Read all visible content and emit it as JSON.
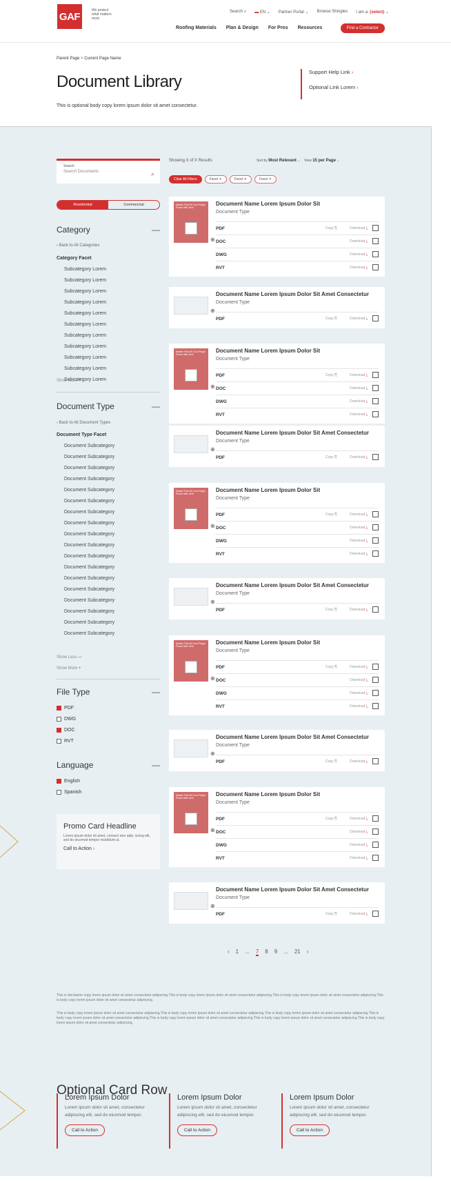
{
  "header": {
    "logo": "GAF",
    "tagline": "We protect what matters most",
    "search": "Search",
    "lang": "EN",
    "partner": "Partner Portal",
    "browse": "Browse Shingles",
    "iam": "I am a:",
    "iam_sel": "(select)",
    "nav": [
      "Roofing Materials",
      "Plan & Design",
      "For Pros",
      "Resources"
    ],
    "cta": "Find a Contractor"
  },
  "breadcrumb": {
    "parent": "Parent Page",
    "arrow": ">",
    "current": "Current Page Name"
  },
  "title": "Document Library",
  "intro": "This is optional body copy lorem ipsum dolor sit amet consectetur.",
  "side_links": [
    "Support Help Link",
    "Optional Link Lorem"
  ],
  "search": {
    "label": "Search",
    "placeholder": "Search Documents"
  },
  "toggle": [
    "Residential",
    "Commercial"
  ],
  "category": {
    "title": "Category",
    "back": "Back to All Categories",
    "facet": "Category Facet",
    "subs": [
      "Subcategory Lorem",
      "Subcategory Lorem",
      "Subcategory Lorem",
      "Subcategory Lorem",
      "Subcategory Lorem",
      "Subcategory Lorem",
      "Subcategory Lorem",
      "Subcategory Lorem",
      "Subcategory Lorem",
      "Subcategory Lorem",
      "Subcategory Lorem"
    ],
    "more": "Show More"
  },
  "doctype": {
    "title": "Document Type",
    "back": "Back to All Document Types",
    "facet": "Document Type Facet",
    "subs": [
      "Document Subcategory",
      "Document Subcategory",
      "Document Subcategory",
      "Document Subcategory",
      "Document Subcategory",
      "Document Subcategory",
      "Document Subcategory",
      "Document Subcategory",
      "Document Subcategory",
      "Document Subcategory",
      "Document Subcategory",
      "Document Subcategory",
      "Document Subcategory",
      "Document Subcategory",
      "Document Subcategory",
      "Document Subcategory",
      "Document Subcategory",
      "Document Subcategory"
    ],
    "less": "Show Less",
    "more": "Show More"
  },
  "filetype": {
    "title": "File Type",
    "items": [
      {
        "label": "PDF",
        "checked": true
      },
      {
        "label": "DWG",
        "checked": false
      },
      {
        "label": "DOC",
        "checked": true
      },
      {
        "label": "RVT",
        "checked": false
      }
    ]
  },
  "language": {
    "title": "Language",
    "items": [
      {
        "label": "English",
        "checked": true
      },
      {
        "label": "Spanish",
        "checked": false
      }
    ]
  },
  "promo": {
    "title": "Promo Card Headline",
    "body": "Lorem ipsum dolor sit amet, consect etur adip. iscing elit, sed do eiusmod tempor incididunt ut.",
    "cta": "Call to Action"
  },
  "results": {
    "showing": "Showing X of X Results",
    "sort_label": "Sort by",
    "sort_value": "Most Relevant",
    "view_label": "View",
    "view_value": "15 per Page",
    "clear": "Clear All Filters",
    "facets": [
      "Facet",
      "Facet",
      "Facet"
    ]
  },
  "docs": {
    "name_a": "Document Name Lorem Ipsum Dolor Sit",
    "name_b": "Document Name Lorem Ipsum Dolor Sit Amet Consectetur",
    "type": "Document Type",
    "copy": "Copy",
    "download": "Download",
    "thumb_text": "Master Flow Ell Cool Plugin Power Attic Vent",
    "formats_a": [
      "PDF",
      "DOC",
      "DWG",
      "RVT"
    ],
    "formats_b": [
      "PDF"
    ]
  },
  "pagination": [
    "‹",
    "1",
    "...",
    "7",
    "8",
    "9",
    "...",
    "21",
    "›"
  ],
  "disclaimer": [
    "This is disclaimer copy lorem ipsum dolor sit amet consectetur adipiscing.This is body copy lorem ipsum dolor sit amet consectetur adipiscing.This is body copy lorem ipsum dolor sit amet consectetur adipiscing.This is body copy lorem ipsum dolor sit amet consectetur adipiscing.",
    "This is body copy lorem ipsum dolor sit amet consectetur adipiscing.This is body copy lorem ipsum dolor sit amet consectetur adipiscing.This is body copy lorem ipsum dolor sit amet consectetur adipiscing.This is body copy lorem ipsum dolor sit amet consectetur adipiscing.This is body copy lorem ipsum dolor sit amet consectetur adipiscing.This is body copy lorem ipsum dolor sit amet consectetur adipiscing.This is body copy lorem ipsum dolor sit amet consectetur adipiscing."
  ],
  "card_row": {
    "title": "Optional Card Row",
    "cards": [
      {
        "title": "Lorem Ipsum Dolor",
        "body": "Lorem ipsum dolor sit amet, consectetur adipiscing elit, sed do eiusmod tempor.",
        "cta": "Call to Action"
      },
      {
        "title": "Lorem Ipsum Dolor",
        "body": "Lorem ipsum dolor sit amet, consectetur adipiscing elit, sed do eiusmod tempor.",
        "cta": "Call to Action"
      },
      {
        "title": "Lorem Ipsum Dolor",
        "body": "Lorem ipsum dolor sit amet, consectetur adipiscing elit, sed do eiusmod tempor.",
        "cta": "Call to Action"
      }
    ]
  },
  "colors": {
    "brand": "#d32f2f",
    "panel": "#e8eff2"
  }
}
